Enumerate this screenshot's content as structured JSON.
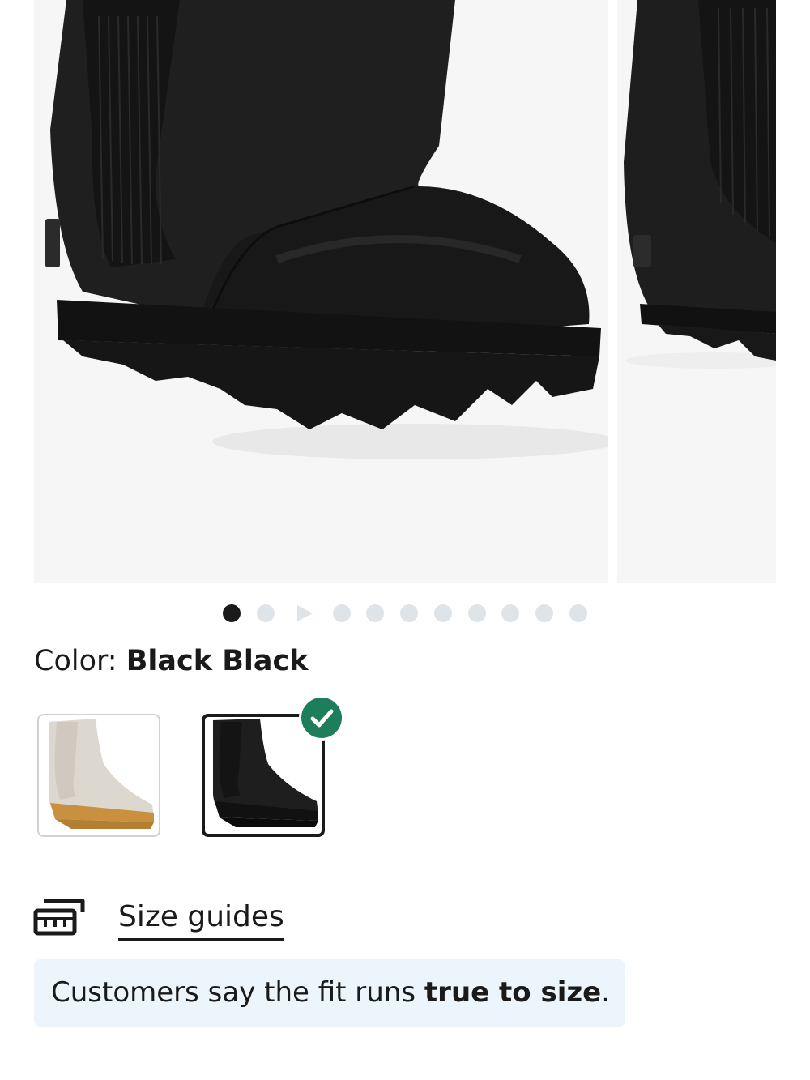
{
  "carousel": {
    "images": [
      {
        "name": "boot-black-closeup",
        "color": "#1c1c1c"
      },
      {
        "name": "boot-black-side",
        "color": "#1c1c1c"
      }
    ],
    "dot_count": 11,
    "active_index": 0,
    "video_index": 2
  },
  "color": {
    "label": "Color:",
    "value": "Black Black"
  },
  "swatches": [
    {
      "name": "Cream/Gum",
      "selected": false,
      "boot_color": "#dcd7cf",
      "sole_color": "#c9913f"
    },
    {
      "name": "Black Black",
      "selected": true,
      "boot_color": "#1e1e1e",
      "sole_color": "#111111"
    }
  ],
  "size_guides": {
    "icon": "ruler-card-icon",
    "label": "Size guides"
  },
  "fit": {
    "prefix": "Customers say the fit runs ",
    "emphasis": "true to size",
    "suffix": "."
  },
  "colors": {
    "selected_check": "#1e7d5a",
    "banner_bg": "#ecf4fc",
    "dot_inactive": "#dfe4e8",
    "dot_active": "#1a1a1a"
  }
}
